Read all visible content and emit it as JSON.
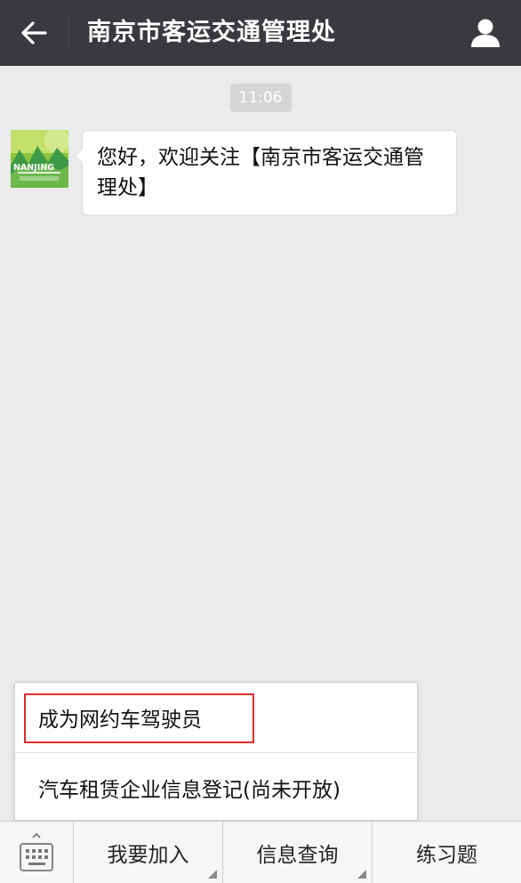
{
  "header": {
    "title": "南京市客运交通管理处",
    "back_icon": "arrow-left-icon",
    "profile_icon": "person-icon"
  },
  "chat": {
    "timestamp": "11:06",
    "message": "您好，欢迎关注【南京市客运交通管理处】",
    "avatar_text": "NANJING"
  },
  "popup_menu": {
    "items": [
      {
        "label": "成为网约车驾驶员"
      },
      {
        "label": "汽车租赁企业信息登记(尚未开放)"
      }
    ]
  },
  "bottom_menu": {
    "keyboard_icon": "keyboard-icon",
    "items": [
      {
        "label": "我要加入"
      },
      {
        "label": "信息查询"
      },
      {
        "label": "练习题"
      }
    ]
  },
  "colors": {
    "topbar": "#393a3f",
    "background": "#ebebeb",
    "highlight": "#e02c2c"
  }
}
